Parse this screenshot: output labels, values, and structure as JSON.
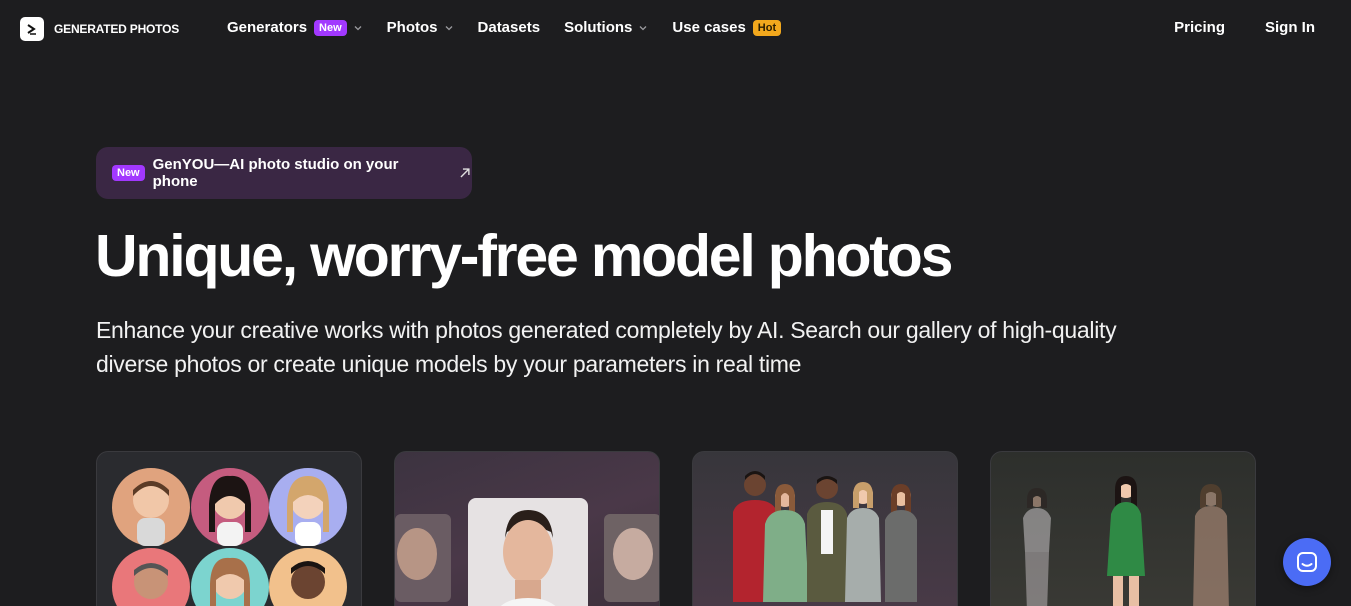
{
  "brand": {
    "name": "GENERATED PHOTOS"
  },
  "nav": {
    "items": [
      {
        "label": "Generators",
        "badge": "New",
        "dropdown": true
      },
      {
        "label": "Photos",
        "dropdown": true
      },
      {
        "label": "Datasets"
      },
      {
        "label": "Solutions",
        "dropdown": true
      },
      {
        "label": "Use cases",
        "badge": "Hot"
      }
    ],
    "pricing": "Pricing",
    "signin": "Sign In"
  },
  "promo": {
    "badge": "New",
    "text": "GenYOU—AI photo studio on your phone"
  },
  "hero": {
    "title": "Unique, worry-free model photos",
    "subtitle": "Enhance your creative works with photos generated completely by AI. Search our gallery of high-quality diverse photos or create unique models by your parameters in real time"
  },
  "cards": [
    {
      "name": "faces-generator",
      "icon": "face-grid"
    },
    {
      "name": "face-generator",
      "icon": "portrait"
    },
    {
      "name": "full-body-generator",
      "icon": "group-photo"
    },
    {
      "name": "human-generator",
      "icon": "body-variations"
    }
  ],
  "colors": {
    "background": "#1d1d1f",
    "badge_new": "#a238ff",
    "badge_hot": "#f2a81d",
    "promo_bg": "#3a2744",
    "chat": "#4b6cf5"
  }
}
